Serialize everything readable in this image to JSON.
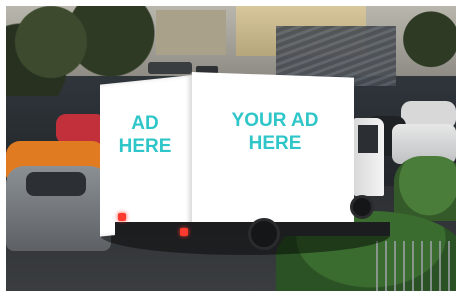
{
  "ad": {
    "left_panel_line1": "AD",
    "left_panel_line2": "HERE",
    "right_panel_line1": "YOUR AD",
    "right_panel_line2": "HERE"
  },
  "colors": {
    "ad_text": "#2fc6c9",
    "billboard": "#ffffff"
  }
}
